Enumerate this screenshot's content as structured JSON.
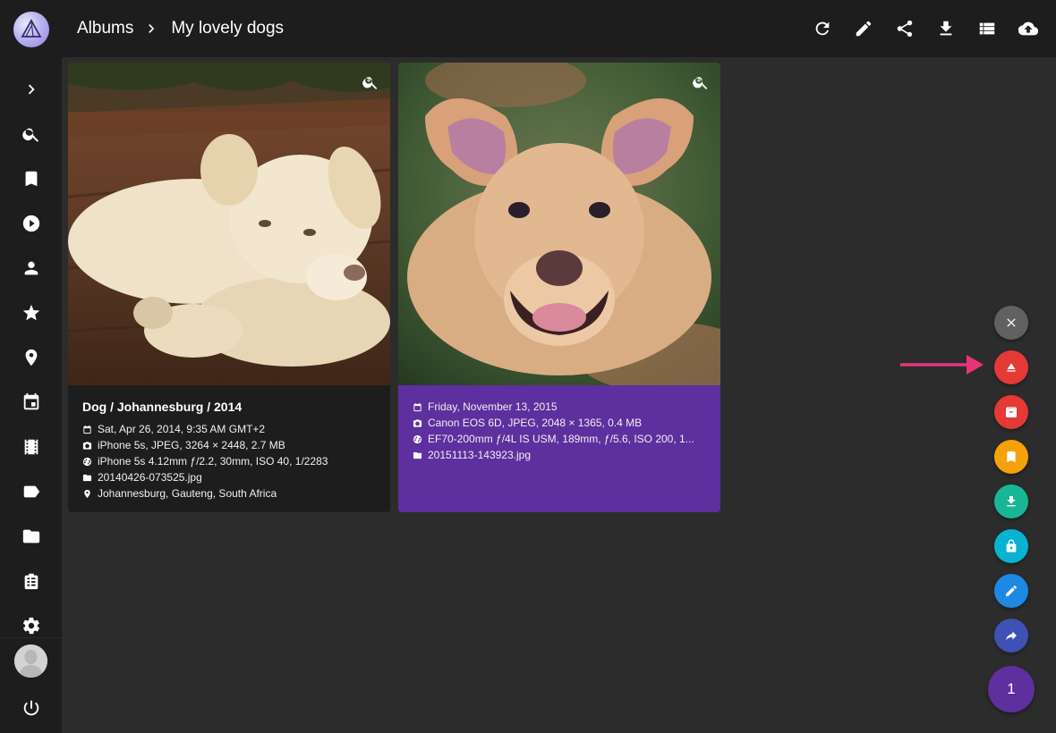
{
  "sidebar": {
    "items": [
      {
        "name": "expand",
        "icon": "chevron-right-icon"
      },
      {
        "name": "search",
        "icon": "search-icon"
      },
      {
        "name": "bookmarks",
        "icon": "bookmark-icon"
      },
      {
        "name": "videos",
        "icon": "play-circle-icon"
      },
      {
        "name": "people",
        "icon": "person-icon"
      },
      {
        "name": "favorites",
        "icon": "star-icon"
      },
      {
        "name": "places",
        "icon": "map-pin-icon"
      },
      {
        "name": "calendar",
        "icon": "calendar-icon"
      },
      {
        "name": "moments",
        "icon": "film-icon"
      },
      {
        "name": "labels",
        "icon": "label-icon"
      },
      {
        "name": "folders",
        "icon": "folder-icon"
      },
      {
        "name": "library",
        "icon": "library-icon"
      },
      {
        "name": "settings",
        "icon": "gear-icon"
      }
    ],
    "logout_icon": "power-icon"
  },
  "header": {
    "breadcrumb_root": "Albums",
    "breadcrumb_current": "My lovely dogs",
    "tools": [
      "refresh-icon",
      "pencil-icon",
      "share-icon",
      "download-icon",
      "list-view-icon",
      "upload-cloud-icon"
    ]
  },
  "photos": [
    {
      "title": "Dog / Johannesburg / 2014",
      "date": "Sat, Apr 26, 2014, 9:35 AM GMT+2",
      "camera": "iPhone 5s, JPEG, 3264 × 2448, 2.7 MB",
      "lens": "iPhone 5s 4.12mm ƒ/2.2, 30mm, ISO 40, 1/2283",
      "file": "20140426-073525.jpg",
      "location": "Johannesburg, Gauteng, South Africa",
      "selected": false
    },
    {
      "date": "Friday, November 13, 2015",
      "camera": "Canon EOS 6D, JPEG, 2048 × 1365, 0.4 MB",
      "lens": "EF70-200mm ƒ/4L IS USM, 189mm, ƒ/5.6, ISO 200, 1...",
      "file": "20151113-143923.jpg",
      "selected": true
    }
  ],
  "actions": {
    "buttons": [
      {
        "name": "clear-selection",
        "icon": "close-icon",
        "color": "#616161"
      },
      {
        "name": "remove-from-album",
        "icon": "eject-icon",
        "color": "#e53935"
      },
      {
        "name": "archive",
        "icon": "archive-icon",
        "color": "#e53935"
      },
      {
        "name": "add-to-album",
        "icon": "bookmark-icon",
        "color": "#f5a20a"
      },
      {
        "name": "download",
        "icon": "download-icon",
        "color": "#17b796"
      },
      {
        "name": "private",
        "icon": "lock-icon",
        "color": "#08b3d1"
      },
      {
        "name": "edit",
        "icon": "pencil-icon",
        "color": "#1e88e5"
      },
      {
        "name": "share",
        "icon": "share-arrow-icon",
        "color": "#3f51b5"
      }
    ],
    "selection_count": "1",
    "arrow_color": "#e8357a"
  },
  "colors": {
    "background": "#2c2c2c",
    "sidebar": "#1d1d1d",
    "selected_card": "#5e2f9e"
  }
}
